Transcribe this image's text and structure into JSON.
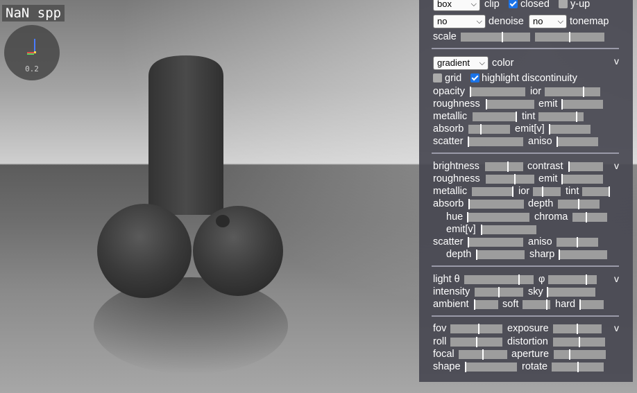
{
  "overlay": {
    "spp_text": "NaN spp",
    "gizmo_value": "0.2"
  },
  "colors": {
    "panel_bg": "#484852",
    "slider_track": "#9d9d9d",
    "checkbox_on": "#1a73e8",
    "axis_x": "#e24a4a",
    "axis_y": "#4a7cff",
    "axis_z": "#ffd84a"
  },
  "panel": {
    "top": {
      "select1": "box",
      "clip": "clip",
      "closed": "closed",
      "closed_checked": true,
      "yup": "y-up",
      "yup_checked": false,
      "denoise_select1": "no",
      "denoise": "denoise",
      "denoise_select2": "no",
      "tonemap": "tonemap",
      "scale": "scale"
    },
    "material": {
      "mode_select": "gradient",
      "color": "color",
      "collapse": "v",
      "grid": "grid",
      "grid_checked": false,
      "highlight": "highlight discontinuity",
      "highlight_checked": true,
      "opacity": "opacity",
      "ior": "ior",
      "roughness": "roughness",
      "emit": "emit",
      "metallic": "metallic",
      "tint": "tint",
      "absorb": "absorb",
      "emit_v": "emit[v]",
      "scatter": "scatter",
      "aniso": "aniso",
      "sliders": {
        "opacity": 0.0,
        "ior": 0.7,
        "roughness": 0.0,
        "emit": 0.0,
        "metallic": 1.0,
        "tint": 0.85,
        "absorb": 0.3,
        "emit_v": 0.0,
        "scatter": 0.0,
        "aniso": 0.0
      }
    },
    "background": {
      "brightness": "brightness",
      "contrast": "contrast",
      "collapse": "v",
      "roughness": "roughness",
      "emit": "emit",
      "metallic": "metallic",
      "ior": "ior",
      "tint": "tint",
      "absorb": "absorb",
      "depth": "depth",
      "hue": "hue",
      "chroma": "chroma",
      "emit_v": "emit[v]",
      "scatter": "scatter",
      "aniso": "aniso",
      "depth2": "depth",
      "sharp": "sharp",
      "sliders": {
        "brightness": 0.6,
        "contrast": 0.0,
        "roughness": 0.6,
        "emit": 0.0,
        "metallic": 1.0,
        "ior": 0.35,
        "tint": 1.0,
        "absorb": 0.0,
        "depth": 0.5,
        "hue": 0.0,
        "chroma": 0.4,
        "emit_v": 0.0,
        "scatter": 0.0,
        "aniso": 0.5,
        "depth2": 0.0,
        "sharp": 0.0
      }
    },
    "light": {
      "light": "light θ",
      "phi": "φ",
      "collapse": "v",
      "intensity": "intensity",
      "sky": "sky",
      "ambient": "ambient",
      "soft": "soft",
      "hard": "hard",
      "sliders": {
        "light": 0.8,
        "phi": 0.8,
        "intensity": 0.5,
        "sky": 0.0,
        "ambient": 0.0,
        "soft": 0.9,
        "hard": 0.0
      }
    },
    "camera": {
      "fov": "fov",
      "exposure": "exposure",
      "collapse": "v",
      "roll": "roll",
      "distortion": "distortion",
      "focal": "focal",
      "aperture": "aperture",
      "shape": "shape",
      "rotate": "rotate",
      "sliders": {
        "fov": 0.55,
        "exposure": 0.5,
        "roll": 0.5,
        "distortion": 0.5,
        "focal": 0.5,
        "aperture": 0.3,
        "shape": 0.0,
        "rotate": 0.5
      }
    }
  }
}
